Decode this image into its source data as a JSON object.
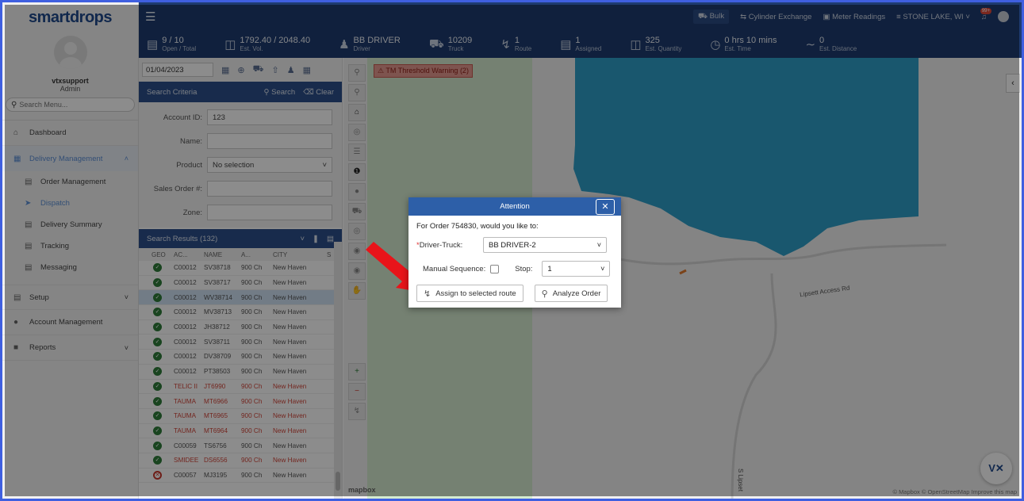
{
  "brand": {
    "name": "smartdrops"
  },
  "user": {
    "name": "vtxsupport",
    "role": "Admin"
  },
  "sidebar": {
    "search_placeholder": "Search Menu...",
    "items": [
      {
        "label": "Dashboard",
        "icon": "home-icon"
      },
      {
        "label": "Delivery Management",
        "icon": "truck-icon"
      },
      {
        "label": "Setup",
        "icon": "setup-icon"
      },
      {
        "label": "Account Management",
        "icon": "users-icon"
      },
      {
        "label": "Reports",
        "icon": "report-icon"
      }
    ],
    "sub_items": [
      {
        "label": "Order Management"
      },
      {
        "label": "Dispatch"
      },
      {
        "label": "Delivery Summary"
      },
      {
        "label": "Tracking"
      },
      {
        "label": "Messaging"
      }
    ]
  },
  "topbar": {
    "bulk": "Bulk",
    "cylinder": "Cylinder Exchange",
    "meter": "Meter Readings",
    "location": "STONE LAKE, WI",
    "badge": "99+"
  },
  "stats": [
    {
      "value": "9 / 10",
      "label": "Open / Total",
      "icon": "list-icon"
    },
    {
      "value": "1792.40 / 2048.40",
      "label": "Est. Vol.",
      "icon": "tank-icon"
    },
    {
      "value": "BB DRIVER",
      "label": "Driver",
      "icon": "driver-icon"
    },
    {
      "value": "10209",
      "label": "Truck",
      "icon": "truck-icon"
    },
    {
      "value": "1",
      "label": "Route",
      "icon": "route-icon"
    },
    {
      "value": "1",
      "label": "Assigned",
      "icon": "list-icon"
    },
    {
      "value": "325",
      "label": "Est. Quantity",
      "icon": "tank-icon"
    },
    {
      "value": "0 hrs 10 mins",
      "label": "Est. Time",
      "icon": "clock-icon"
    },
    {
      "value": "0",
      "label": "Est. Distance",
      "icon": "distance-icon"
    }
  ],
  "panel": {
    "date": "01/04/2023",
    "criteria_title": "Search Criteria",
    "search_label": "Search",
    "clear_label": "Clear",
    "fields": {
      "account_label": "Account ID:",
      "account_value": "123",
      "name_label": "Name:",
      "product_label": "Product",
      "product_value": "No selection",
      "sales_label": "Sales Order #:",
      "zone_label": "Zone:"
    },
    "results_title": "Search Results (132)",
    "columns": [
      "GEO",
      "AC...",
      "NAME",
      "A...",
      "CITY",
      "S"
    ],
    "rows": [
      {
        "ac": "C00012",
        "name": "SV38718",
        "a": "900 Ch",
        "city": "New Haven",
        "geo": "ok",
        "red": false,
        "sel": false
      },
      {
        "ac": "C00012",
        "name": "SV38717",
        "a": "900 Ch",
        "city": "New Haven",
        "geo": "ok",
        "red": false,
        "sel": false
      },
      {
        "ac": "C00012",
        "name": "WV38714",
        "a": "900 Ch",
        "city": "New Haven",
        "geo": "ok",
        "red": false,
        "sel": true
      },
      {
        "ac": "C00012",
        "name": "MV38713",
        "a": "900 Ch",
        "city": "New Haven",
        "geo": "ok",
        "red": false,
        "sel": false
      },
      {
        "ac": "C00012",
        "name": "JH38712",
        "a": "900 Ch",
        "city": "New Haven",
        "geo": "ok",
        "red": false,
        "sel": false
      },
      {
        "ac": "C00012",
        "name": "SV38711",
        "a": "900 Ch",
        "city": "New Haven",
        "geo": "ok",
        "red": false,
        "sel": false
      },
      {
        "ac": "C00012",
        "name": "DV38709",
        "a": "900 Ch",
        "city": "New Haven",
        "geo": "ok",
        "red": false,
        "sel": false
      },
      {
        "ac": "C00012",
        "name": "PT38503",
        "a": "900 Ch",
        "city": "New Haven",
        "geo": "ok",
        "red": false,
        "sel": false
      },
      {
        "ac": "TELIC II",
        "name": "JT6990",
        "a": "900 Ch",
        "city": "New Haven",
        "geo": "ok",
        "red": true,
        "sel": false
      },
      {
        "ac": "TAUMA",
        "name": "MT6966",
        "a": "900 Ch",
        "city": "New Haven",
        "geo": "ok",
        "red": true,
        "sel": false
      },
      {
        "ac": "TAUMA",
        "name": "MT6965",
        "a": "900 Ch",
        "city": "New Haven",
        "geo": "ok",
        "red": true,
        "sel": false
      },
      {
        "ac": "TAUMA",
        "name": "MT6964",
        "a": "900 Ch",
        "city": "New Haven",
        "geo": "ok",
        "red": true,
        "sel": false
      },
      {
        "ac": "C00059",
        "name": "TS6756",
        "a": "900 Ch",
        "city": "New Haven",
        "geo": "ok",
        "red": false,
        "sel": false
      },
      {
        "ac": "SMIDEE",
        "name": "DS6556",
        "a": "900 Ch",
        "city": "New Haven",
        "geo": "ok",
        "red": true,
        "sel": false
      },
      {
        "ac": "C00057",
        "name": "MJ3195",
        "a": "900 Ch",
        "city": "New Haven",
        "geo": "x",
        "red": false,
        "sel": false
      }
    ]
  },
  "map": {
    "warning": "TM Threshold Warning (2)",
    "road": "Lipsett Access Rd",
    "road2": "S Lipset",
    "attribution": "© Mapbox © OpenStreetMap  Improve this map",
    "mapbox": "mapbox",
    "vx": "V✕",
    "colors": {
      "water": "#2e9fc9",
      "land": "#f0f0f0",
      "green": "#d5ecd0"
    }
  },
  "dialog": {
    "title": "Attention",
    "question": "For Order 754830, would you like to:",
    "driver_label": "Driver-Truck:",
    "driver_value": "BB DRIVER-2",
    "manual_label": "Manual Sequence:",
    "stop_label": "Stop:",
    "stop_value": "1",
    "assign_label": "Assign to selected route",
    "analyze_label": "Analyze Order"
  }
}
